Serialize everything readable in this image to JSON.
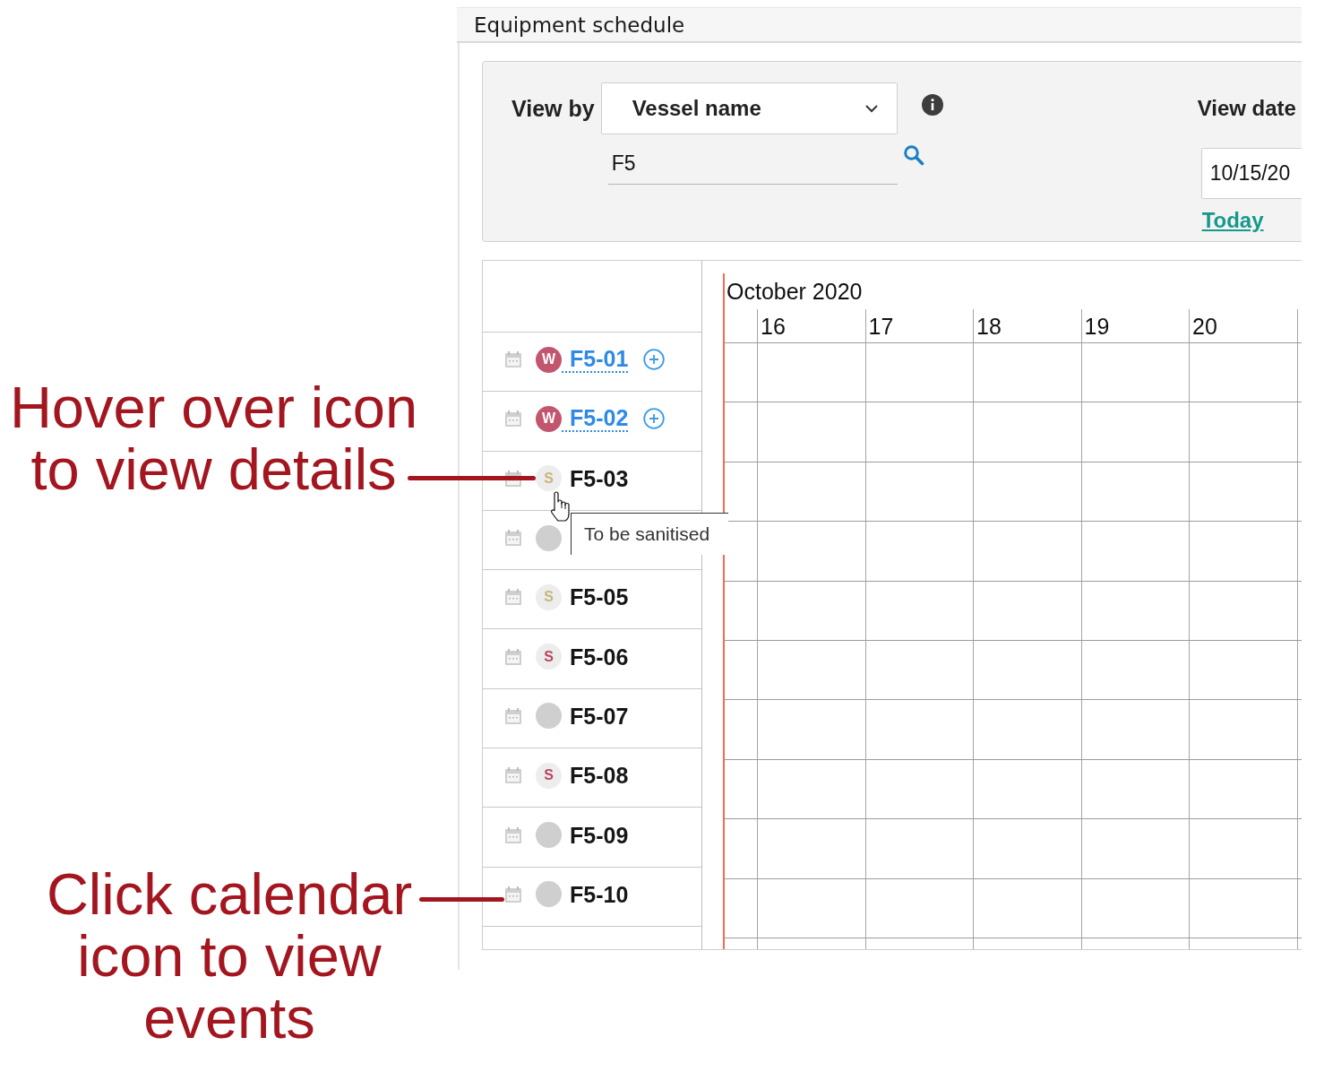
{
  "window": {
    "title": "Equipment schedule"
  },
  "filters": {
    "view_by": {
      "label": "View by",
      "value": "Vessel name"
    },
    "search": {
      "value": "F5"
    },
    "view_date": {
      "label": "View date",
      "value": "10/15/20",
      "today_link": "Today"
    }
  },
  "schedule": {
    "month": "October 2020",
    "days": [
      "16",
      "17",
      "18",
      "19",
      "20"
    ],
    "rows": [
      {
        "label": "F5-01",
        "kind": "link",
        "status": {
          "kind": "filled",
          "letter": "W",
          "color": "#c2566f"
        }
      },
      {
        "label": "F5-02",
        "kind": "link",
        "status": {
          "kind": "filled",
          "letter": "W",
          "color": "#c2566f"
        }
      },
      {
        "label": "F5-03",
        "kind": "plain",
        "tooltip": "To be sanitised",
        "status": {
          "kind": "soft",
          "letter": "S",
          "color": "#c8b576"
        }
      },
      {
        "kind": "plain",
        "status": {
          "kind": "empty",
          "color": "#cfcfcf"
        }
      },
      {
        "label": "F5-05",
        "kind": "plain",
        "status": {
          "kind": "soft",
          "letter": "S",
          "color": "#c8b576"
        }
      },
      {
        "label": "F5-06",
        "kind": "plain",
        "status": {
          "kind": "soft",
          "letter": "S",
          "color": "#b9475f"
        }
      },
      {
        "label": "F5-07",
        "kind": "plain",
        "status": {
          "kind": "empty",
          "color": "#cfcfcf"
        }
      },
      {
        "label": "F5-08",
        "kind": "plain",
        "status": {
          "kind": "soft",
          "letter": "S",
          "color": "#b9475f"
        }
      },
      {
        "label": "F5-09",
        "kind": "plain",
        "status": {
          "kind": "empty",
          "color": "#cfcfcf"
        }
      },
      {
        "label": "F5-10",
        "kind": "plain",
        "status": {
          "kind": "empty",
          "color": "#cfcfcf"
        }
      }
    ]
  },
  "annotations": [
    {
      "text": "Hover over icon to view details"
    },
    {
      "text": "Click calendar icon to view events"
    }
  ]
}
